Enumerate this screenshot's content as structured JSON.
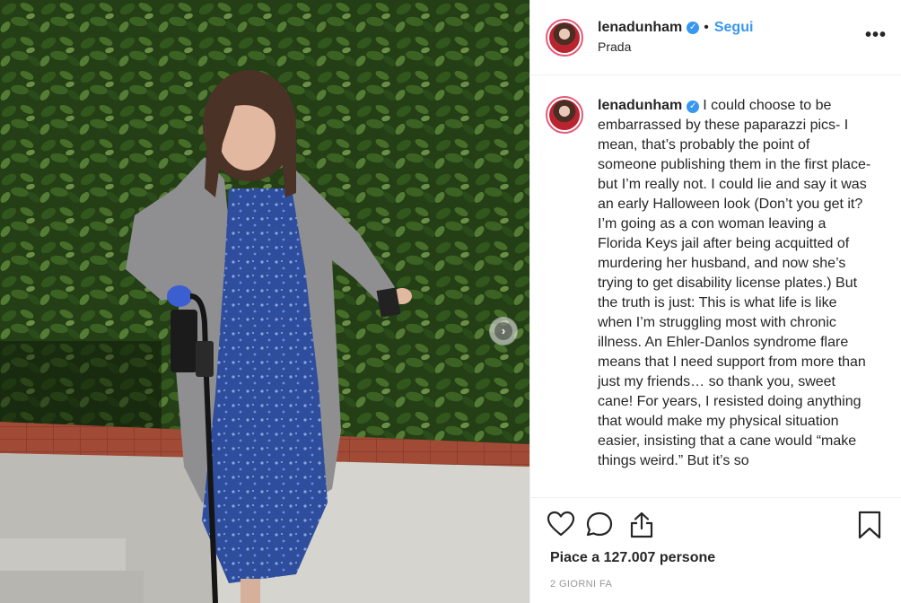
{
  "header": {
    "username": "lenadunham",
    "verified_icon": "verified-badge-icon",
    "separator": "•",
    "follow_label": "Segui",
    "location": "Prada",
    "more_icon": "more-options-icon"
  },
  "photo": {
    "description_icon": "photo",
    "carousel_next_icon": "chevron-right-icon"
  },
  "caption": {
    "username": "lenadunham",
    "text": "I could choose to be embarrassed by these paparazzi pics- I mean, that’s probably the point of someone publishing them in the first place- but I’m really not. I could lie and say it was an early Halloween look (Don’t you get it? I’m going as a con woman leaving a Florida Keys jail after being acquitted of murdering her husband, and now she’s trying to get disability license plates.) But the truth is just: This is what life is like when I’m struggling most with chronic illness. An Ehler-Danlos syndrome flare means that I need support from more than just my friends… so thank you, sweet cane! For years, I resisted doing anything that would make my physical situation easier, insisting that a cane would “make things weird.” But it’s so"
  },
  "actions": {
    "like_icon": "heart-icon",
    "comment_icon": "comment-icon",
    "share_icon": "share-icon",
    "save_icon": "bookmark-icon"
  },
  "likes": {
    "prefix": "Piace a",
    "count": "127.007",
    "suffix": "persone"
  },
  "timestamp": "2 GIORNI FA",
  "colors": {
    "accent": "#3897f0",
    "text": "#262626",
    "muted": "#999999",
    "border": "#efefef"
  }
}
